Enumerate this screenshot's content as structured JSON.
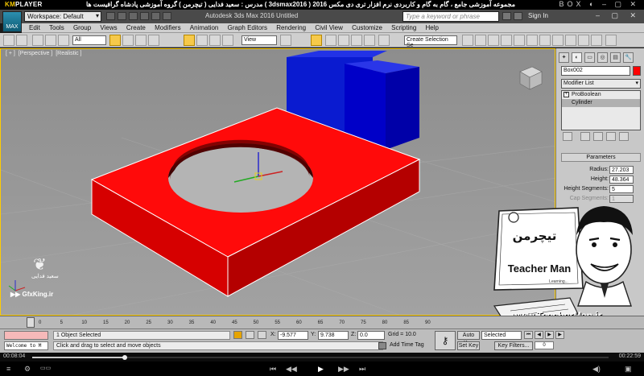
{
  "player": {
    "logo_prefix": "KM",
    "logo_suffix": "PLAYER",
    "title": "مجموعه آموزشی جامع ، گام به گام و کاربردی نرم افزار تری دی مکس 2016  ( 3dsmax2016 )  مدرس : سعید فدایی ( تیچرمن ) گروه آموزشی پادشاه گرافیست ها",
    "controls": "BOX ◐ – ▢ ✕",
    "current_time": "00:08:04",
    "total_time": "00:22:59",
    "progress_percent": 35
  },
  "max": {
    "logo_label": "MAX",
    "workspace": "Workspace: Default",
    "app_title": "Autodesk 3ds Max 2016    Untitled",
    "search_placeholder": "Type a keyword or phrase",
    "sign_in": "Sign In",
    "window_controls": "– ▢ ✕",
    "menus": [
      "Edit",
      "Tools",
      "Group",
      "Views",
      "Create",
      "Modifiers",
      "Animation",
      "Graph Editors",
      "Rendering",
      "Civil View",
      "Customize",
      "Scripting",
      "Help"
    ],
    "toolbar": {
      "filter": "All",
      "ref_coord": "View",
      "selection_set": "Create Selection Se"
    }
  },
  "viewport": {
    "label_plus": "[ + ]",
    "label_view": "[Perspective ]",
    "label_shading": "[Realistic ]"
  },
  "watermark": {
    "author": "سعید فدایی",
    "site": "▶▶ GfxKing.ir"
  },
  "command_panel": {
    "tabs": [
      "✦",
      "◐",
      "▭",
      "◎",
      "▤",
      "🔧"
    ],
    "object_name": "Box002",
    "object_color": "#ff0000",
    "modifier_list": "Modifier List",
    "stack": [
      {
        "label": "ProBoolean",
        "toggle": "+"
      },
      {
        "label": "Cylinder",
        "toggle": ""
      }
    ],
    "rollout_title": "Parameters",
    "params": [
      {
        "label": "Radius:",
        "value": "27.203"
      },
      {
        "label": "Height:",
        "value": "48.364"
      },
      {
        "label": "Height Segments:",
        "value": "5"
      },
      {
        "label": "Cap Segments:",
        "value": "1"
      }
    ]
  },
  "teacherman": {
    "brand": "Teacher Man",
    "brand_fa": "تیچرمن",
    "tagline": "Learning...",
    "url": "www.TeacherMan.ir"
  },
  "timeline": {
    "ticks": [
      "0",
      "5",
      "10",
      "15",
      "20",
      "25",
      "30",
      "35",
      "40",
      "45",
      "50",
      "55",
      "60",
      "65",
      "70",
      "75",
      "80",
      "85",
      "90"
    ]
  },
  "status": {
    "listener": "Welcome to M",
    "selection": "1 Object Selected",
    "prompt": "Click and drag to select and move objects",
    "x_label": "X:",
    "x_value": "-9.577",
    "y_label": "Y:",
    "y_value": "9.738",
    "z_label": "Z:",
    "z_value": "0.0",
    "grid": "Grid = 10.0",
    "add_time_tag": "Add Time Tag",
    "auto_key": "Auto Key",
    "set_key": "Set Key",
    "selected": "Selected",
    "key_filters": "Key Filters...",
    "frame": "0"
  },
  "colors": {
    "viewport_bg": "#999999",
    "box_red": "#ff0000",
    "box_blue": "#0000cc",
    "accent_yellow": "#f6c94a"
  }
}
